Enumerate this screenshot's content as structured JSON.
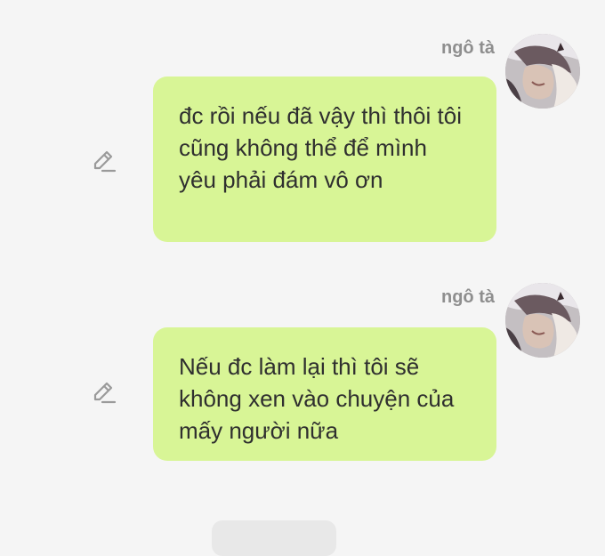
{
  "messages": [
    {
      "sender": "ngô tà",
      "text": "đc rồi nếu đã vậy thì thôi tôi cũng không thể để mình yêu phải đám vô ơn"
    },
    {
      "sender": "ngô tà",
      "text": "Nếu đc làm lại thì tôi sẽ không xen vào chuyện của mấy người nữa"
    }
  ],
  "icons": {
    "edit": "pencil-icon",
    "avatar": "avatar"
  },
  "colors": {
    "background": "#f5f5f5",
    "bubble": "#d8f596",
    "sender": "#8e8e8e",
    "text": "#2f2f2f",
    "icon": "#9a9a9a"
  }
}
